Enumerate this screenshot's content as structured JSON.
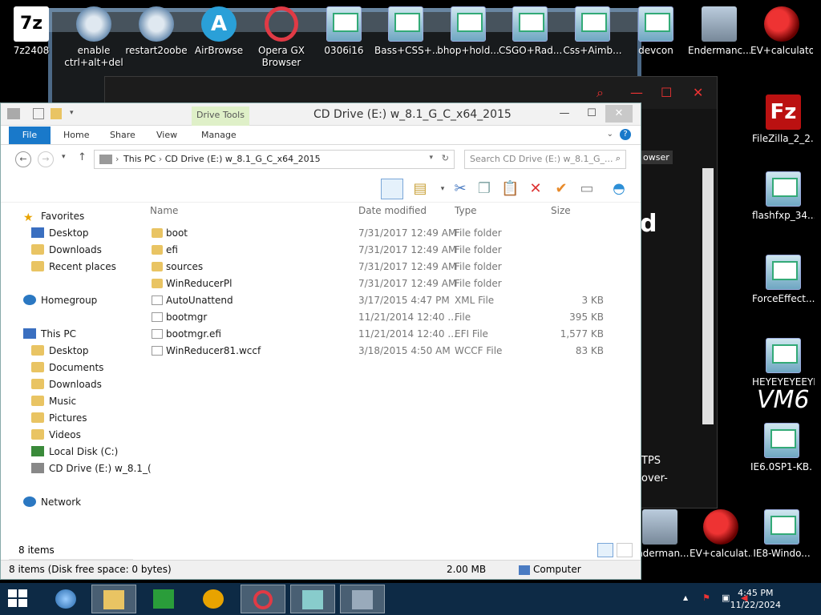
{
  "desktop_icons_top": [
    {
      "label": "7z2408",
      "icon": "7z-icon",
      "text": "7z"
    },
    {
      "label": "enable\nctrl+alt+del",
      "icon": "gear-icon"
    },
    {
      "label": "restart2oobe",
      "icon": "gear-icon"
    },
    {
      "label": "AirBrowse",
      "icon": "airbrowse-icon",
      "text": "A"
    },
    {
      "label": "Opera GX\nBrowser",
      "icon": "opera-icon"
    },
    {
      "label": "0306i16",
      "icon": "app-icon"
    },
    {
      "label": "Bass+CSS+...",
      "icon": "app-icon"
    },
    {
      "label": "bhop+hold...",
      "icon": "app-icon"
    },
    {
      "label": "CSGO+Rad...",
      "icon": "app-icon"
    },
    {
      "label": "Css+Aimb...",
      "icon": "app-icon"
    },
    {
      "label": "devcon",
      "icon": "app-icon"
    },
    {
      "label": "Endermanc...",
      "icon": "computer-icon"
    },
    {
      "label": "EV+calculator",
      "icon": "spartan-icon"
    }
  ],
  "desktop_icons_right": [
    {
      "label": "FileZilla_2_2...",
      "icon": "filezilla-icon",
      "text": "Fz"
    },
    {
      "label": "flashfxp_34...",
      "icon": "app-icon"
    },
    {
      "label": "ForceEffect...",
      "icon": "app-icon"
    },
    {
      "label": "HEYEYEYEEYE",
      "icon": "app-icon"
    },
    {
      "label": "IE6.0SP1-KB...",
      "icon": "app-icon"
    }
  ],
  "desktop_icons_bottom": [
    {
      "label": "Enderman...",
      "icon": "computer-icon"
    },
    {
      "label": "EV+calculat...",
      "icon": "spartan-icon"
    },
    {
      "label": "IE8-Windo...",
      "icon": "app-icon"
    }
  ],
  "right_scraps": {
    "d": "d",
    "tps": "TPS",
    "over": "over-",
    "vm6": "VM6",
    "owser": "owser"
  },
  "explorer": {
    "title": "CD Drive (E:) w_8.1_G_C_x64_2015",
    "drive_tools": "Drive Tools",
    "tabs": [
      "File",
      "Home",
      "Share",
      "View",
      "Manage"
    ],
    "breadcrumb": [
      "This PC",
      "CD Drive (E:) w_8.1_G_C_x64_2015"
    ],
    "search_placeholder": "Search CD Drive (E:) w_8.1_G_...",
    "columns": [
      "Name",
      "Date modified",
      "Type",
      "Size"
    ],
    "files": [
      {
        "name": "boot",
        "date": "7/31/2017 12:49 AM",
        "type": "File folder",
        "size": "",
        "kind": "folder"
      },
      {
        "name": "efi",
        "date": "7/31/2017 12:49 AM",
        "type": "File folder",
        "size": "",
        "kind": "folder"
      },
      {
        "name": "sources",
        "date": "7/31/2017 12:49 AM",
        "type": "File folder",
        "size": "",
        "kind": "folder"
      },
      {
        "name": "WinReducerPl",
        "date": "7/31/2017 12:49 AM",
        "type": "File folder",
        "size": "",
        "kind": "folder"
      },
      {
        "name": "AutoUnattend",
        "date": "3/17/2015 4:47 PM",
        "type": "XML File",
        "size": "3 KB",
        "kind": "doc"
      },
      {
        "name": "bootmgr",
        "date": "11/21/2014 12:40 ...",
        "type": "File",
        "size": "395 KB",
        "kind": "doc"
      },
      {
        "name": "bootmgr.efi",
        "date": "11/21/2014 12:40 ...",
        "type": "EFI File",
        "size": "1,577 KB",
        "kind": "doc"
      },
      {
        "name": "WinReducer81.wccf",
        "date": "3/18/2015 4:50 AM",
        "type": "WCCF File",
        "size": "83 KB",
        "kind": "doc"
      }
    ],
    "nav": {
      "favorites": "Favorites",
      "fav_items": [
        "Desktop",
        "Downloads",
        "Recent places"
      ],
      "homegroup": "Homegroup",
      "thispc": "This PC",
      "pc_items": [
        "Desktop",
        "Documents",
        "Downloads",
        "Music",
        "Pictures",
        "Videos",
        "Local Disk (C:)",
        "CD Drive (E:) w_8.1_("
      ],
      "network": "Network"
    },
    "item_count": "8 items",
    "status_left": "8 items (Disk free space: 0 bytes)",
    "status_size": "2.00 MB",
    "status_location": "Computer"
  },
  "taskbar": {
    "time": "4:45 PM",
    "date": "11/22/2024"
  },
  "colors": {
    "accent": "#1979ca",
    "taskbar": "#0d2a45",
    "opera": "#e03a45"
  }
}
